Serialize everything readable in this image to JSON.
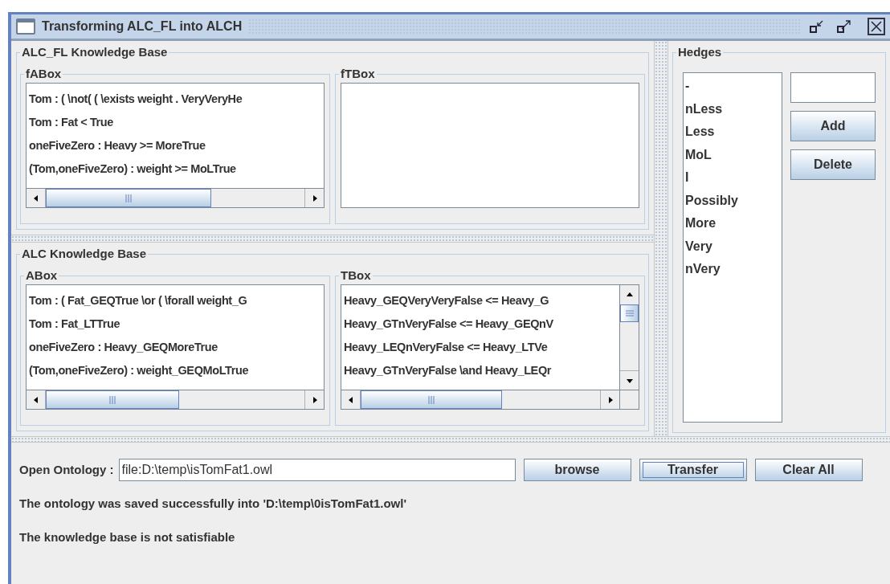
{
  "window": {
    "title": "Transforming ALC_FL into ALCH"
  },
  "alc_fl_kb": {
    "title": "ALC_FL Knowledge Base",
    "fabox": {
      "title": "fABox",
      "lines": [
        "Tom : ( \\not( ( \\exists weight . VeryVeryHe",
        "Tom : Fat < True",
        "oneFiveZero : Heavy >= MoreTrue",
        "(Tom,oneFiveZero) : weight >= MoLTrue"
      ]
    },
    "ftbox": {
      "title": "fTBox"
    }
  },
  "alc_kb": {
    "title": "ALC Knowledge Base",
    "abox": {
      "title": "ABox",
      "lines": [
        "Tom : ( Fat_GEQTrue \\or ( \\forall weight_G",
        "Tom : Fat_LTTrue",
        "oneFiveZero : Heavy_GEQMoreTrue",
        "(Tom,oneFiveZero) : weight_GEQMoLTrue"
      ]
    },
    "tbox": {
      "title": "TBox",
      "lines": [
        "Heavy_GEQVeryVeryFalse <= Heavy_G",
        "Heavy_GTnVeryFalse <= Heavy_GEQnV",
        "Heavy_LEQnVeryFalse <= Heavy_LTVe",
        "Heavy_GTnVeryFalse \\and Heavy_LEQr"
      ]
    }
  },
  "hedges": {
    "title": "Hedges",
    "items": [
      {
        "label": "-"
      },
      {
        "label": "nLess"
      },
      {
        "label": "Less"
      },
      {
        "label": "MoL"
      },
      {
        "label": "I"
      },
      {
        "label": "Possibly"
      },
      {
        "label": "More"
      },
      {
        "label": "Very"
      },
      {
        "label": "nVery"
      }
    ],
    "buttons": [
      "Add",
      "Delete"
    ]
  },
  "open_ontology": {
    "label": "Open Ontology :",
    "value": "file:D:\\temp\\isTomFat1.owl"
  },
  "buttons": [
    {
      "label": "browse",
      "focused": false
    },
    {
      "label": "Transfer",
      "focused": true
    },
    {
      "label": "Clear All",
      "focused": false
    }
  ],
  "messages": [
    "The ontology was saved successfully into 'D:\\temp\\0isTomFat1.owl'",
    "The knowledge base is not satisfiable"
  ]
}
